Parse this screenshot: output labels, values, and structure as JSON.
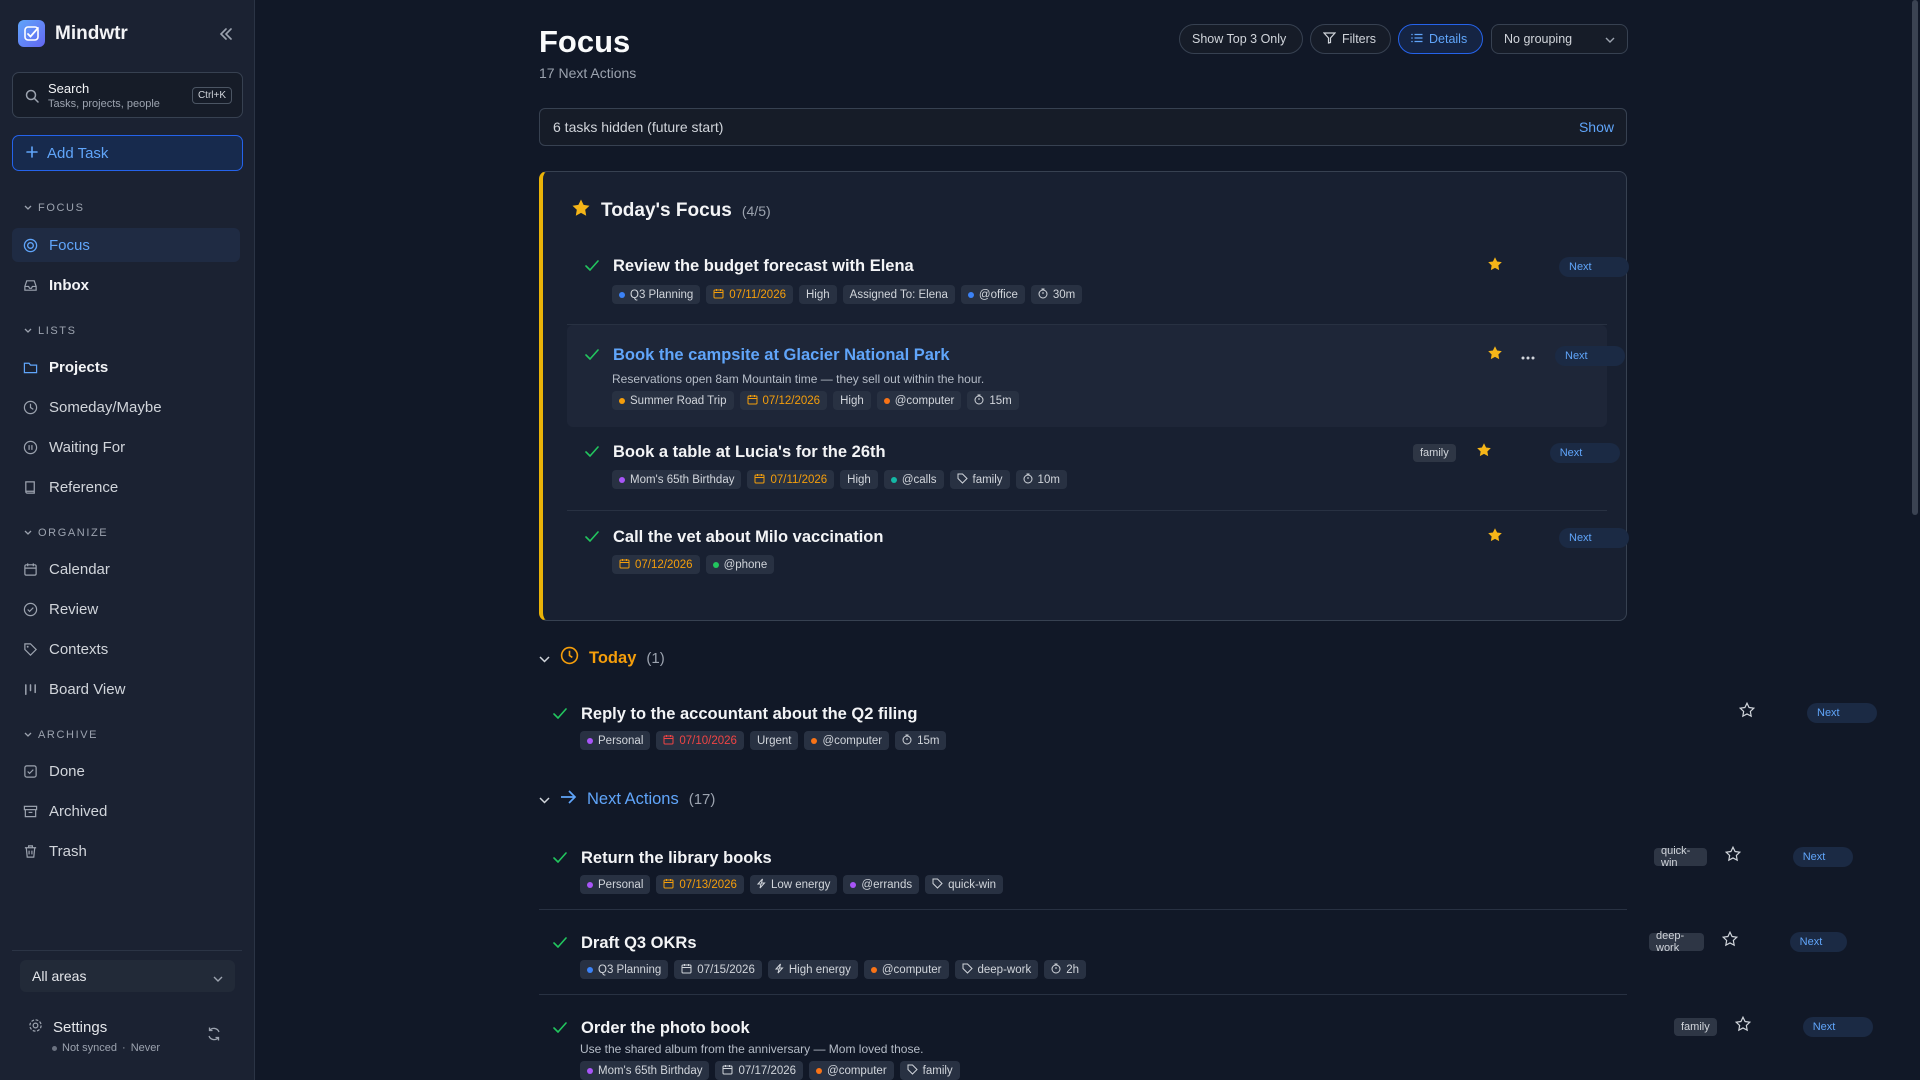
{
  "app": {
    "name": "Mindwtr"
  },
  "sidebar": {
    "search": {
      "title": "Search",
      "subtitle": "Tasks, projects, people",
      "shortcut": "Ctrl+K"
    },
    "add_task": "Add Task",
    "sections": {
      "focus": "FOCUS",
      "lists": "LISTS",
      "organize": "ORGANIZE",
      "archive": "ARCHIVE"
    },
    "items": {
      "focus": "Focus",
      "inbox": "Inbox",
      "projects": "Projects",
      "someday": "Someday/Maybe",
      "waiting": "Waiting For",
      "reference": "Reference",
      "calendar": "Calendar",
      "review": "Review",
      "contexts": "Contexts",
      "board": "Board View",
      "done": "Done",
      "archived": "Archived",
      "trash": "Trash"
    },
    "areas": "All areas",
    "settings": "Settings",
    "sync_status": "Not synced",
    "sync_sep": "·",
    "sync_time": "Never"
  },
  "header": {
    "title": "Focus",
    "subtitle": "17 Next Actions"
  },
  "toolbar": {
    "top3": "Show Top 3 Only",
    "filters": "Filters",
    "details": "Details",
    "grouping": "No grouping"
  },
  "hidden": {
    "text": "6 tasks hidden (future start)",
    "action": "Show"
  },
  "focus_panel": {
    "title": "Today's Focus",
    "count": "(4/5)",
    "tasks": [
      {
        "title": "Review the budget forecast with Elena",
        "project": "Q3 Planning",
        "date": "07/11/2026",
        "priority": "High",
        "assigned": "Assigned To: Elena",
        "context": "@office",
        "time": "30m",
        "status": "Next"
      },
      {
        "title": "Book the campsite at Glacier National Park",
        "note": "Reservations open 8am Mountain time — they sell out within the hour.",
        "project": "Summer Road Trip",
        "date": "07/12/2026",
        "priority": "High",
        "context": "@computer",
        "time": "15m",
        "status": "Next"
      },
      {
        "title": "Book a table at Lucia's for the 26th",
        "project": "Mom's 65th Birthday",
        "date": "07/11/2026",
        "priority": "High",
        "context": "@calls",
        "tag": "family",
        "time": "10m",
        "badge": "family",
        "status": "Next"
      },
      {
        "title": "Call the vet about Milo vaccination",
        "date": "07/12/2026",
        "context": "@phone",
        "status": "Next"
      }
    ]
  },
  "today": {
    "title": "Today",
    "count": "(1)",
    "tasks": [
      {
        "title": "Reply to the accountant about the Q2 filing",
        "project": "Personal",
        "date": "07/10/2026",
        "priority": "Urgent",
        "context": "@computer",
        "time": "15m",
        "status": "Next"
      }
    ]
  },
  "next_actions": {
    "title": "Next Actions",
    "count": "(17)",
    "tasks": [
      {
        "title": "Return the library books",
        "project": "Personal",
        "date": "07/13/2026",
        "energy": "Low energy",
        "context": "@errands",
        "tag": "quick-win",
        "badge": "quick-win",
        "status": "Next"
      },
      {
        "title": "Draft Q3 OKRs",
        "project": "Q3 Planning",
        "date": "07/15/2026",
        "energy": "High energy",
        "context": "@computer",
        "tag": "deep-work",
        "time": "2h",
        "badge": "deep-work",
        "status": "Next"
      },
      {
        "title": "Order the photo book",
        "note": "Use the shared album from the anniversary — Mom loved those.",
        "project": "Mom's 65th Birthday",
        "date": "07/17/2026",
        "context": "@computer",
        "tag": "family",
        "badge": "family",
        "status": "Next"
      }
    ]
  },
  "colors": {
    "accent": "#60a5fa",
    "focus_border": "#eab308",
    "star": "#f5b518",
    "check": "#22c55e",
    "overdue": "#ef4444",
    "due": "#f59e0b"
  }
}
